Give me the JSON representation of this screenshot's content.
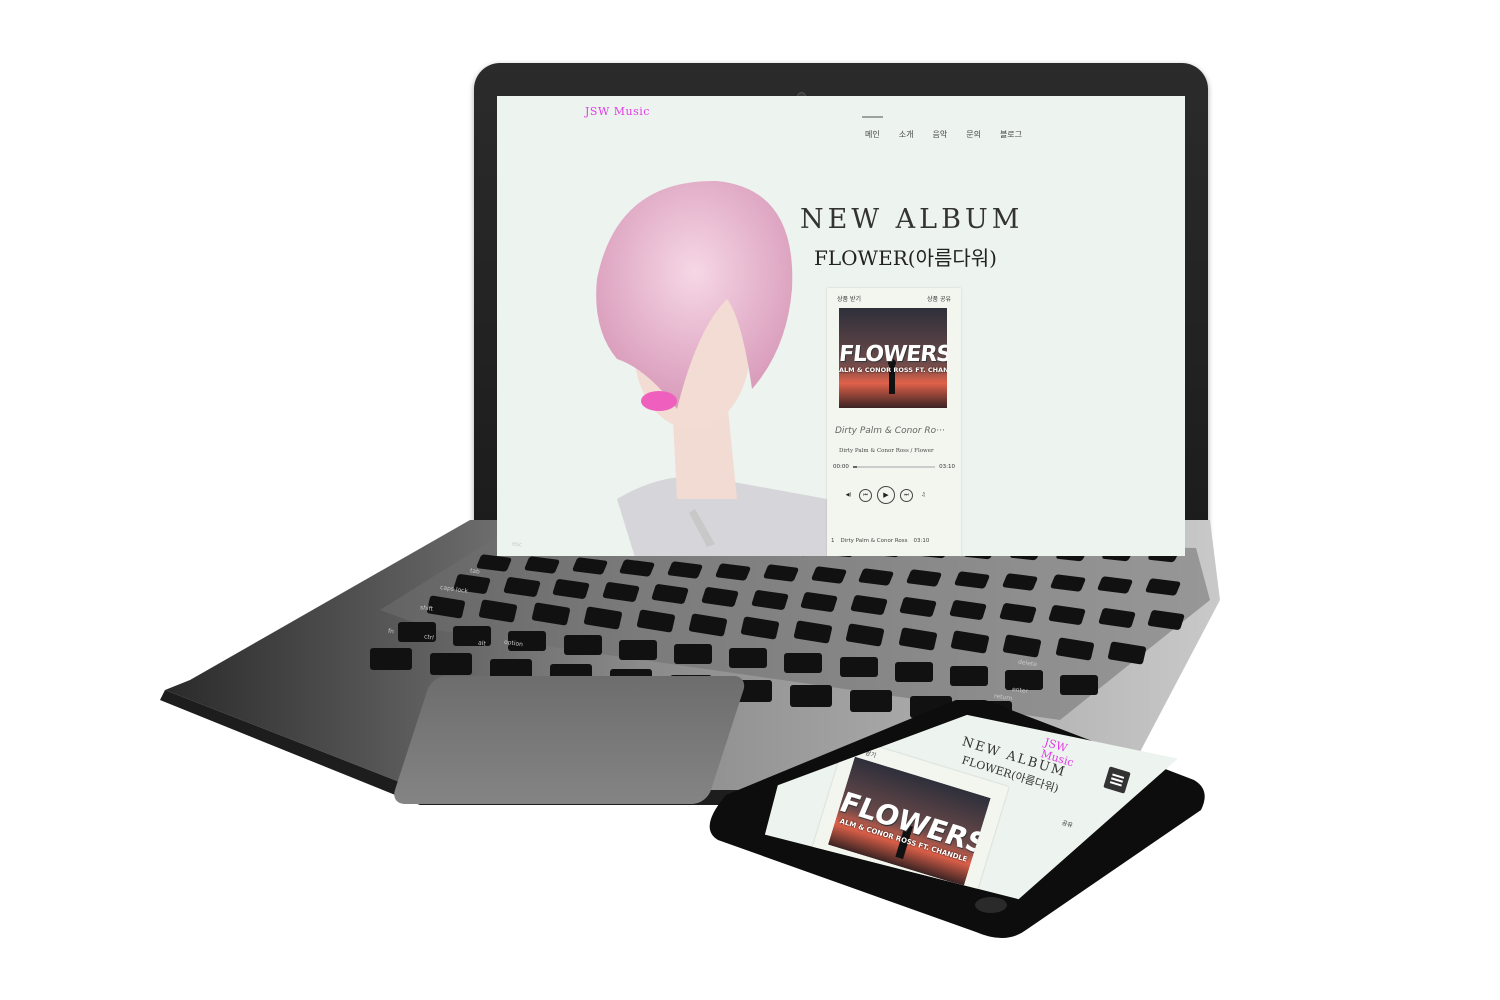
{
  "site": {
    "brand": "JSW Music",
    "nav": [
      "메인",
      "소개",
      "음악",
      "문의",
      "블로그"
    ],
    "hero_title": "NEW ALBUM",
    "hero_subtitle": "FLOWER(아름다워)"
  },
  "player": {
    "top_left": "상품 받기",
    "top_right": "상품 공유",
    "cover_word": "FLOWERS",
    "cover_sub": "ALM & CONOR ROSS FT. CHANDLE",
    "track_title": "Dirty Palm & Conor Ro···",
    "track_sub": "Dirty Palm & Conor Ross / Flower",
    "time_current": "00:00",
    "time_total": "03:10",
    "progress": 0.05,
    "buttons": [
      "volume-icon",
      "prev-icon",
      "play-icon",
      "next-icon",
      "playlist-icon"
    ],
    "playlist_row": {
      "index": "1",
      "title": "Dirty Palm & Conor Ross",
      "time": "03:10"
    }
  },
  "phone": {
    "brand_line1": "JSW",
    "brand_line2": "Music",
    "title": "NEW ALBUM",
    "subtitle": "FLOWER(아름다워)",
    "card_top_left": "상품 받기",
    "cover_word": "FLOWERS",
    "cover_sub": "ALM & CONOR ROSS FT. CHANDLE",
    "share_label": "공유"
  },
  "keyboard": {
    "keys": [
      "esc",
      "tab",
      "caps lock",
      "shift",
      "fn",
      "ctrl",
      "alt",
      "option",
      "delete",
      "enter",
      "return"
    ]
  },
  "colors": {
    "brand": "#e03ee6",
    "screen_bg": "#edf3ee",
    "card_bg": "#f3f6ef"
  }
}
